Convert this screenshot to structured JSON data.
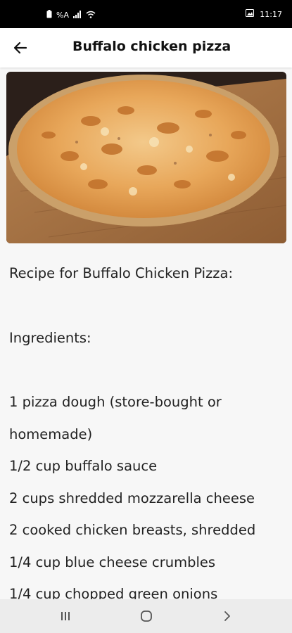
{
  "status_bar": {
    "left_text": "%A",
    "time": "11:17"
  },
  "header": {
    "title": "Buffalo chicken pizza",
    "back_icon": "arrow-left-icon"
  },
  "hero_image": {
    "subject": "buffalo chicken pizza on wooden board"
  },
  "recipe": {
    "heading": "Recipe for Buffalo Chicken Pizza:",
    "ingredients_heading": "Ingredients:",
    "ingredients": [
      "1 pizza dough (store-bought or",
      "homemade)",
      "1/2 cup buffalo sauce",
      "2 cups shredded mozzarella cheese",
      "2 cooked chicken breasts, shredded",
      "1/4 cup blue cheese crumbles",
      "1/4 cup chopped green onions"
    ]
  },
  "nav": {
    "recent_icon": "recent-apps-icon",
    "home_icon": "home-icon",
    "back_icon": "back-chevron-icon"
  }
}
